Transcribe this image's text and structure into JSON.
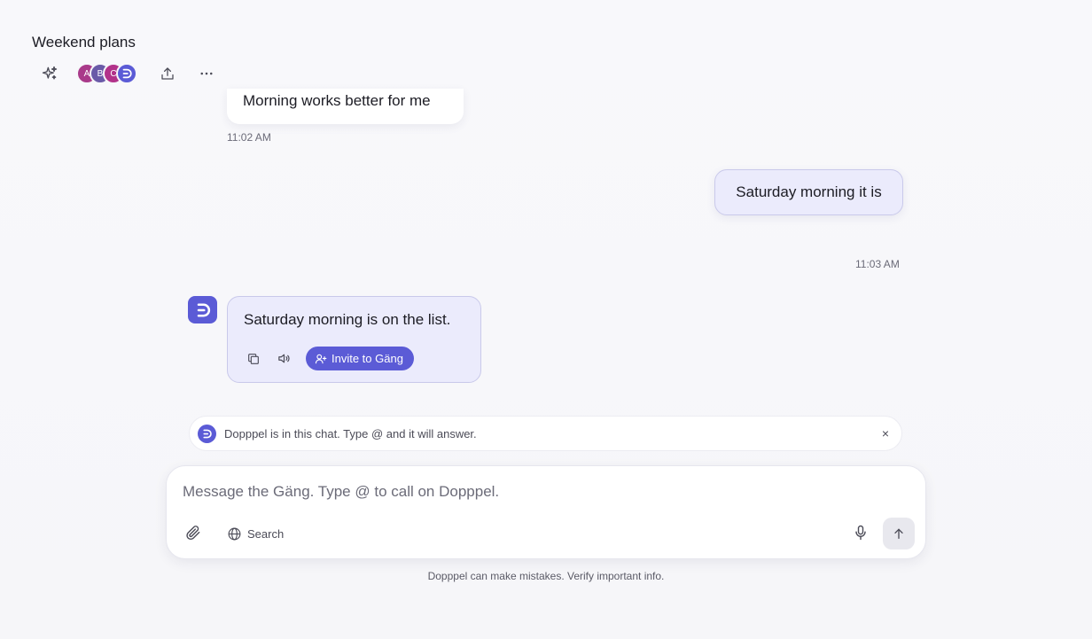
{
  "chat": {
    "title": "Weekend plans"
  },
  "participants": [
    {
      "initial": "A",
      "color": "#a93a8a"
    },
    {
      "initial": "B",
      "color": "#6a5aa8"
    },
    {
      "initial": "C",
      "color": "#b2328a"
    }
  ],
  "messages": {
    "msg1": {
      "text": "Morning works better for me",
      "time": "11:02 AM"
    },
    "msg2": {
      "text": "Saturday morning it is",
      "time": "11:03 AM"
    },
    "bot_reply": {
      "text": "Saturday morning is on the list.",
      "invite_label": "Invite to Gäng"
    }
  },
  "notice": {
    "text": "Dopppel is in this chat. Type @ and it will answer.",
    "close": "×"
  },
  "composer": {
    "placeholder": "Message the Gäng. Type @ to call on Dopppel.",
    "search_label": "Search"
  },
  "footer": {
    "disclaimer": "Dopppel can make mistakes. Verify important info."
  },
  "colors": {
    "accent": "#5b5bd6",
    "outgoing_bubble": "#ebebfc"
  }
}
